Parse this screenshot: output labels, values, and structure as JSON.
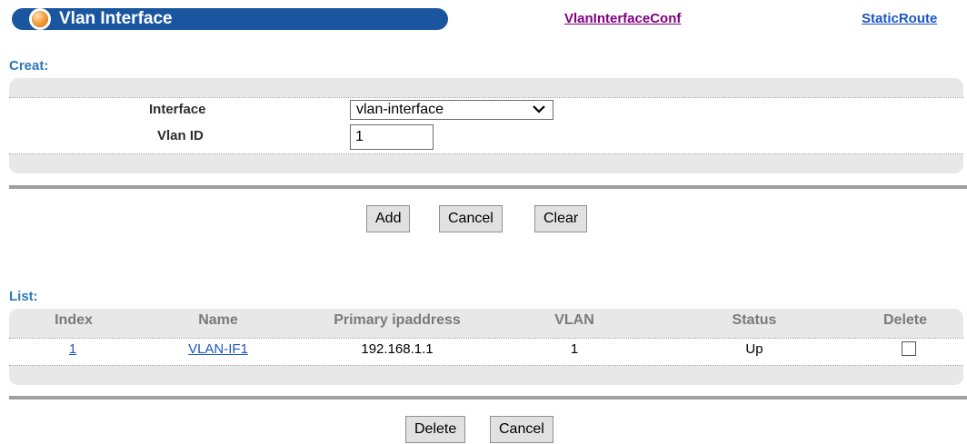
{
  "header": {
    "title": "Vlan Interface",
    "links": {
      "vlan_interface_conf": "VlanInterfaceConf",
      "static_route": "StaticRoute"
    }
  },
  "create": {
    "label": "Creat:",
    "fields": {
      "interface_label": "Interface",
      "interface_value": "vlan-interface",
      "vlan_id_label": "Vlan ID",
      "vlan_id_value": "1"
    },
    "buttons": {
      "add": "Add",
      "cancel": "Cancel",
      "clear": "Clear"
    }
  },
  "list": {
    "label": "List:",
    "columns": [
      "Index",
      "Name",
      "Primary ipaddress",
      "VLAN",
      "Status",
      "Delete"
    ],
    "rows": [
      {
        "index": "1",
        "name": "VLAN-IF1",
        "ip": "192.168.1.1",
        "vlan": "1",
        "status": "Up",
        "delete_checked": false
      }
    ],
    "buttons": {
      "delete": "Delete",
      "cancel": "Cancel"
    }
  },
  "colors": {
    "title_bar": "#1a56a0",
    "section_label": "#2a7ab8",
    "visited_link": "#800080",
    "link": "#1a56c4",
    "panel_bg": "#e8e8e8"
  },
  "icons": {
    "title_knob": "orange-orb-icon",
    "select_arrow": "chevron-down-icon"
  }
}
